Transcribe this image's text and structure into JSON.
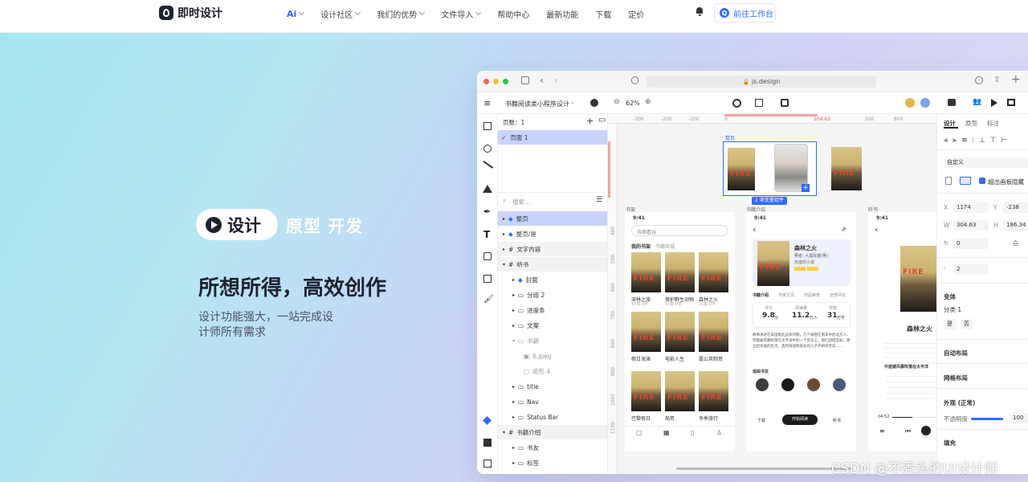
{
  "nav": {
    "brand": "即时设计",
    "ai_label": "Ai",
    "items": [
      "设计社区",
      "我们的优势",
      "文件导入",
      "帮助中心",
      "最新功能",
      "下载",
      "定价"
    ],
    "cta": "前往工作台",
    "cta_icon_letter": "Q"
  },
  "hero": {
    "pill_label": "设计",
    "tabs": "原型  开发",
    "title": "所想所得，高效创作",
    "subtitle": "设计功能强大，一站完成设计师所有需求"
  },
  "window": {
    "url": "js.design",
    "file_name": "书籍阅读类小程序设计",
    "zoom": "62%",
    "pages_label": "页数：1",
    "page_item": "页面 1",
    "search_placeholder": "搜索...",
    "layers": [
      "整页",
      "整页/是",
      "文字内容",
      "听书",
      "封面",
      "分组 2",
      "进度条",
      "文案",
      "书籍",
      "6.jpeg",
      "矩形 4",
      "title",
      "Nav",
      "Status Bar",
      "书籍介绍",
      "书友",
      "标签"
    ],
    "ruler_h": [
      "-300",
      "-200",
      "-100",
      "0",
      "104.63",
      "500",
      "600"
    ],
    "ruler_v": [
      "400",
      "500",
      "600",
      "700",
      "800",
      "900",
      "1000",
      "1100"
    ],
    "frame_labels": [
      "整页",
      "书架",
      "书籍介绍",
      "听书"
    ],
    "variant_badge": "2 项变量组件",
    "phone1": {
      "time": "9:41",
      "search": "去哪看谷",
      "tab1": "我的书架",
      "tab2": "书籍商城",
      "books": [
        "深林之旅",
        "保护野生动物",
        "森林之火",
        "假日海滩",
        "电影人生",
        "露公英制意",
        "巴黎假日",
        "局势",
        "冬季旅行"
      ],
      "meta": "15章·0字"
    },
    "phone2": {
      "time": "9:41",
      "title": "森林之火",
      "author": "著者: 九尾陈猫(著)",
      "tag": "完善的小说",
      "tabs": [
        "书籍介绍",
        "作家主页",
        "作品荣誉",
        "全部评论"
      ],
      "stats": [
        {
          "label": "评分",
          "value": "9.8",
          "unit": "分"
        },
        {
          "label": "阅读量",
          "value": "11.2",
          "unit": "万人"
        },
        {
          "label": "字数",
          "value": "31",
          "unit": "万字"
        }
      ],
      "body": "故事讲述在美国南北战争时期，几个被困在南军中的北方人，带着被风暴吹落在太平洋中的一个荒岛上。他们团结互助，建立起幸福的生活。直到海盗和船长的儿子开始对荒岛……",
      "section": "追踪书友",
      "buttons": [
        "下载",
        "开始阅读",
        "听书"
      ]
    },
    "phone3": {
      "time": "9:41",
      "title": "森林之火",
      "line": "中途被风暴吹落在太平洋",
      "progress": "04:52"
    },
    "props": {
      "tabs": [
        "设计",
        "原型",
        "标注"
      ],
      "constraint": "自定义",
      "clip_label": "超出画板隐藏",
      "x": "1174",
      "y": "-238",
      "w": "304.63",
      "h": "186.34",
      "rotation": "0",
      "radius": "2",
      "variant_title": "变体",
      "variant_name": "分类 1",
      "variant_opts": [
        "是",
        "否"
      ],
      "auto_layout": "自动布局",
      "grid_layout": "网格布局",
      "appearance": "外观 (正常)",
      "opacity_label": "不透明度",
      "opacity": "100",
      "fill": "填充"
    }
  },
  "watermark": "CSDN @不秃头的UI设计师"
}
